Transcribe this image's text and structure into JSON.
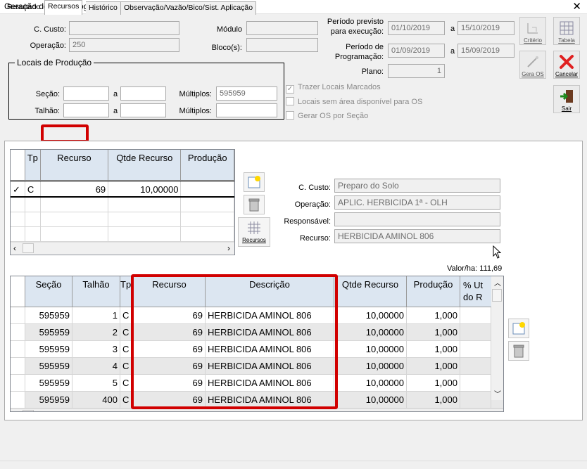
{
  "window": {
    "title": "Geração de OS - Programação",
    "close": "✕"
  },
  "header": {
    "c_custo_label": "C. Custo:",
    "c_custo_value": "",
    "operacao_label": "Operação:",
    "operacao_value": "250",
    "modulo_label": "Módulo",
    "modulo_value": "",
    "bloco_label": "Bloco(s):",
    "bloco_value": "",
    "periodo_prev_label1": "Período previsto",
    "periodo_prev_label2": "para execução:",
    "periodo_prev_from": "01/10/2019",
    "periodo_prev_a": "a",
    "periodo_prev_to": "15/10/2019",
    "periodo_prog_label1": "Período de",
    "periodo_prog_label2": "Programação:",
    "periodo_prog_from": "01/09/2019",
    "periodo_prog_a": "a",
    "periodo_prog_to": "15/09/2019",
    "plano_label": "Plano:",
    "plano_value": "1"
  },
  "toolbar": {
    "criterio": "Critério",
    "tabela": "Tabela",
    "gera_os": "Gera OS",
    "cancelar": "Cancelar",
    "sair": "Sair"
  },
  "locais": {
    "title": "Locais de Produção",
    "secao_label": "Seção:",
    "a1": "a",
    "multiplos1_label": "Múltiplos:",
    "multiplos1_value": "595959",
    "talhao_label": "Talhão:",
    "a2": "a",
    "multiplos2_label": "Múltiplos:",
    "multiplos2_value": ""
  },
  "options": {
    "trazer": "Trazer Locais Marcados",
    "trazer_checked": "✓",
    "locais_sem": "Locais sem área disponível para OS",
    "gerar": "Gerar OS por Seção"
  },
  "tabs": [
    "Resultado",
    "Recursos",
    "Histórico",
    "Observação/Vazão/Bico/Sist. Aplicação"
  ],
  "recursos_grid": {
    "headers": [
      "Tp",
      "Recurso",
      "Qtde Recurso",
      "Produção"
    ],
    "row": {
      "marker": "✓",
      "tp": "C",
      "recurso": "69",
      "qtde": "10,00000",
      "producao": ""
    }
  },
  "recursos_btn": "Recursos",
  "details": {
    "c_custo_label": "C. Custo:",
    "c_custo_value": "Preparo do Solo",
    "operacao_label": "Operação:",
    "operacao_value": "APLIC. HERBICIDA 1ª - OLH",
    "responsavel_label": "Responsável:",
    "responsavel_value": "",
    "recurso_label": "Recurso:",
    "recurso_value": "HERBICIDA AMINOL 806"
  },
  "valor_ha": "Valor/ha: 111,69",
  "bottom_grid": {
    "headers": [
      "Seção",
      "Talhão",
      "Tp",
      "Recurso",
      "Descrição",
      "Qtde Recurso",
      "Produção",
      "% Ut do R"
    ],
    "rows": [
      {
        "secao": "595959",
        "talhao": "1",
        "tp": "C",
        "recurso": "69",
        "descricao": "HERBICIDA AMINOL 806",
        "qtde": "10,00000",
        "producao": "1,000"
      },
      {
        "secao": "595959",
        "talhao": "2",
        "tp": "C",
        "recurso": "69",
        "descricao": "HERBICIDA AMINOL 806",
        "qtde": "10,00000",
        "producao": "1,000"
      },
      {
        "secao": "595959",
        "talhao": "3",
        "tp": "C",
        "recurso": "69",
        "descricao": "HERBICIDA AMINOL 806",
        "qtde": "10,00000",
        "producao": "1,000"
      },
      {
        "secao": "595959",
        "talhao": "4",
        "tp": "C",
        "recurso": "69",
        "descricao": "HERBICIDA AMINOL 806",
        "qtde": "10,00000",
        "producao": "1,000"
      },
      {
        "secao": "595959",
        "talhao": "5",
        "tp": "C",
        "recurso": "69",
        "descricao": "HERBICIDA AMINOL 806",
        "qtde": "10,00000",
        "producao": "1,000"
      },
      {
        "secao": "595959",
        "talhao": "400",
        "tp": "C",
        "recurso": "69",
        "descricao": "HERBICIDA AMINOL 806",
        "qtde": "10,00000",
        "producao": "1,000"
      }
    ]
  },
  "colors": {
    "highlight_red": "#d10000",
    "header_blue": "#dce6f1"
  }
}
